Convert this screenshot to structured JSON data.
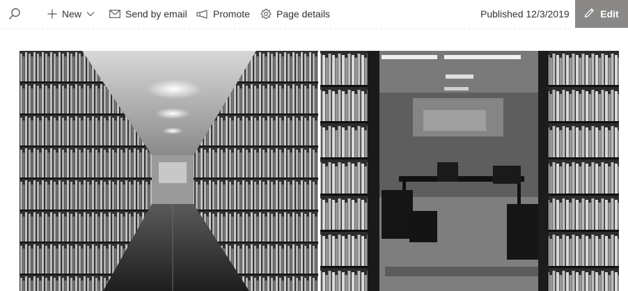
{
  "commandbar": {
    "new_label": "New",
    "send_email_label": "Send by email",
    "promote_label": "Promote",
    "page_details_label": "Page details",
    "published_text": "Published 12/3/2019",
    "edit_label": "Edit"
  },
  "icons": {
    "search": "search-icon",
    "new": "plus-icon",
    "new_dropdown": "chevron-down-icon",
    "email": "mail-icon",
    "promote": "megaphone-icon",
    "details": "gear-icon",
    "edit": "pencil-icon"
  },
  "hero": {
    "left_image": "library-aisle-photo",
    "right_image": "library-reading-room-photo"
  },
  "colors": {
    "edit_button_bg": "#8a8886",
    "text": "#323130"
  }
}
